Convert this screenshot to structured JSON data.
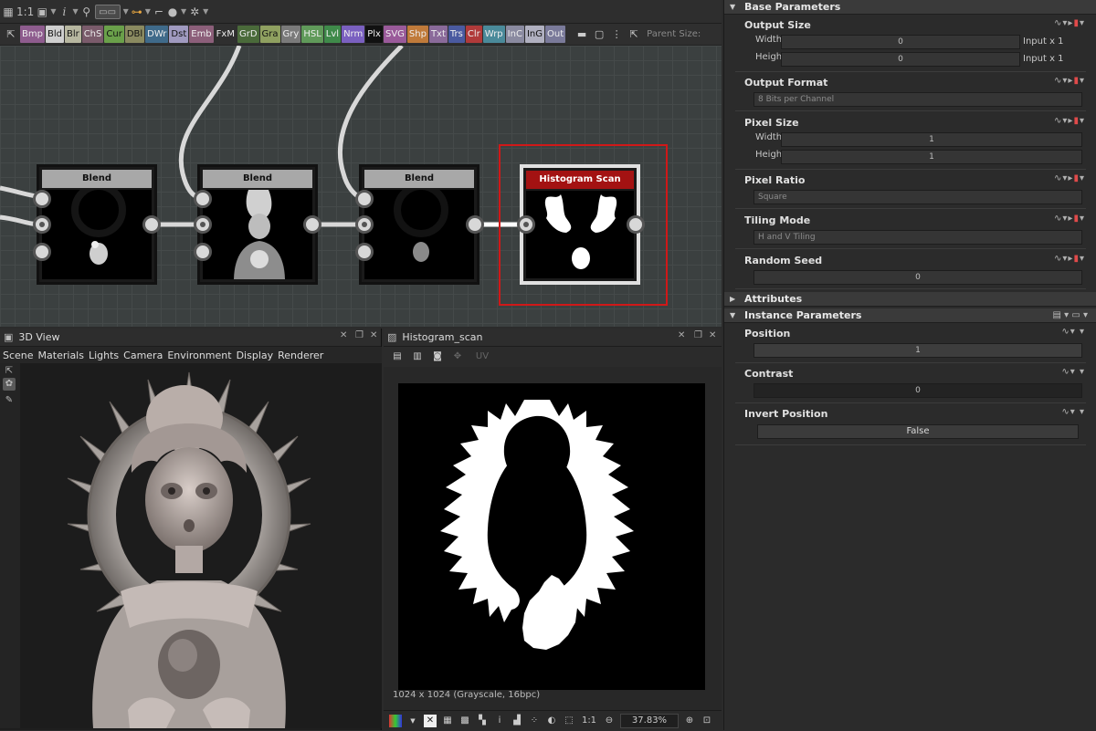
{
  "toolbar": {
    "icons": [
      "layout-icon",
      "fit-icon",
      "info-icon",
      "zoom-icon",
      "frame-icon",
      "link-icon",
      "comment-icon",
      "bomb-icon",
      "gear-icon"
    ],
    "zoom_label": "1:1"
  },
  "palette": {
    "chips": [
      {
        "label": "Bmp",
        "color": "#8e5c8e"
      },
      {
        "label": "Bld",
        "color": "#cfcfcf",
        "dark": true
      },
      {
        "label": "Blr",
        "color": "#b7b7a0",
        "dark": true
      },
      {
        "label": "ChS",
        "color": "#7a5b6b"
      },
      {
        "label": "Cur",
        "color": "#6aa04a",
        "dark": true
      },
      {
        "label": "DBl",
        "color": "#8a8a60",
        "dark": true
      },
      {
        "label": "DWr",
        "color": "#3f6a8a"
      },
      {
        "label": "Dst",
        "color": "#a09ac0",
        "dark": true
      },
      {
        "label": "Emb",
        "color": "#8c5f7a"
      },
      {
        "label": "FxM",
        "color": "#2f2f2f"
      },
      {
        "label": "GrD",
        "color": "#4a6a3a"
      },
      {
        "label": "Gra",
        "color": "#8fa060",
        "dark": true
      },
      {
        "label": "Gry",
        "color": "#7a7a7a"
      },
      {
        "label": "HSL",
        "color": "#609a5a"
      },
      {
        "label": "Lvl",
        "color": "#3f8a4a"
      },
      {
        "label": "Nrm",
        "color": "#7a60c0"
      },
      {
        "label": "Plx",
        "color": "#111111"
      },
      {
        "label": "SVG",
        "color": "#9a5a9a"
      },
      {
        "label": "Shp",
        "color": "#c07a3a"
      },
      {
        "label": "Txt",
        "color": "#8a6a9a"
      },
      {
        "label": "Trs",
        "color": "#4a5aa0"
      },
      {
        "label": "Clr",
        "color": "#b03a3a"
      },
      {
        "label": "Wrp",
        "color": "#4a8a9a"
      },
      {
        "label": "InC",
        "color": "#8a8aa0"
      },
      {
        "label": "InG",
        "color": "#b0b0c0",
        "dark": true
      },
      {
        "label": "Out",
        "color": "#7a7a9a"
      }
    ],
    "parent_size_label": "Parent Size:"
  },
  "graph": {
    "nodes": [
      {
        "id": "blend-1",
        "title": "Blend"
      },
      {
        "id": "blend-2",
        "title": "Blend"
      },
      {
        "id": "blend-3",
        "title": "Blend"
      },
      {
        "id": "histogram-scan",
        "title": "Histogram Scan",
        "selected": true
      }
    ]
  },
  "view3d": {
    "title": "3D View",
    "menu": [
      "Scene",
      "Materials",
      "Lights",
      "Camera",
      "Environment",
      "Display",
      "Renderer"
    ]
  },
  "view2d": {
    "title": "Histogram_scan",
    "uv_label": "UV",
    "image_info": "1024 x 1024 (Grayscale, 16bpc)",
    "zoom": "37.83%",
    "ratio_label": "1:1"
  },
  "params": {
    "base_title": "Base Parameters",
    "output_size": {
      "label": "Output Size",
      "width_label": "Width",
      "width_value": "0",
      "width_suffix": "Input x 1",
      "height_label": "Height",
      "height_value": "0",
      "height_suffix": "Input x 1"
    },
    "output_format": {
      "label": "Output Format",
      "value": "8 Bits per Channel"
    },
    "pixel_size": {
      "label": "Pixel Size",
      "width_label": "Width",
      "width_value": "1",
      "height_label": "Height",
      "height_value": "1"
    },
    "pixel_ratio": {
      "label": "Pixel Ratio",
      "value": "Square"
    },
    "tiling_mode": {
      "label": "Tiling Mode",
      "value": "H and V Tiling"
    },
    "random_seed": {
      "label": "Random Seed",
      "value": "0"
    },
    "attributes_title": "Attributes",
    "instance_title": "Instance Parameters",
    "position": {
      "label": "Position",
      "value": "1",
      "fraction": 1.0
    },
    "contrast": {
      "label": "Contrast",
      "value": "0",
      "fraction": 0.0
    },
    "invert_position": {
      "label": "Invert Position",
      "value": "False"
    }
  },
  "colors": {
    "accent_selection": "#d01818",
    "node_header_selected": "#a31212"
  }
}
